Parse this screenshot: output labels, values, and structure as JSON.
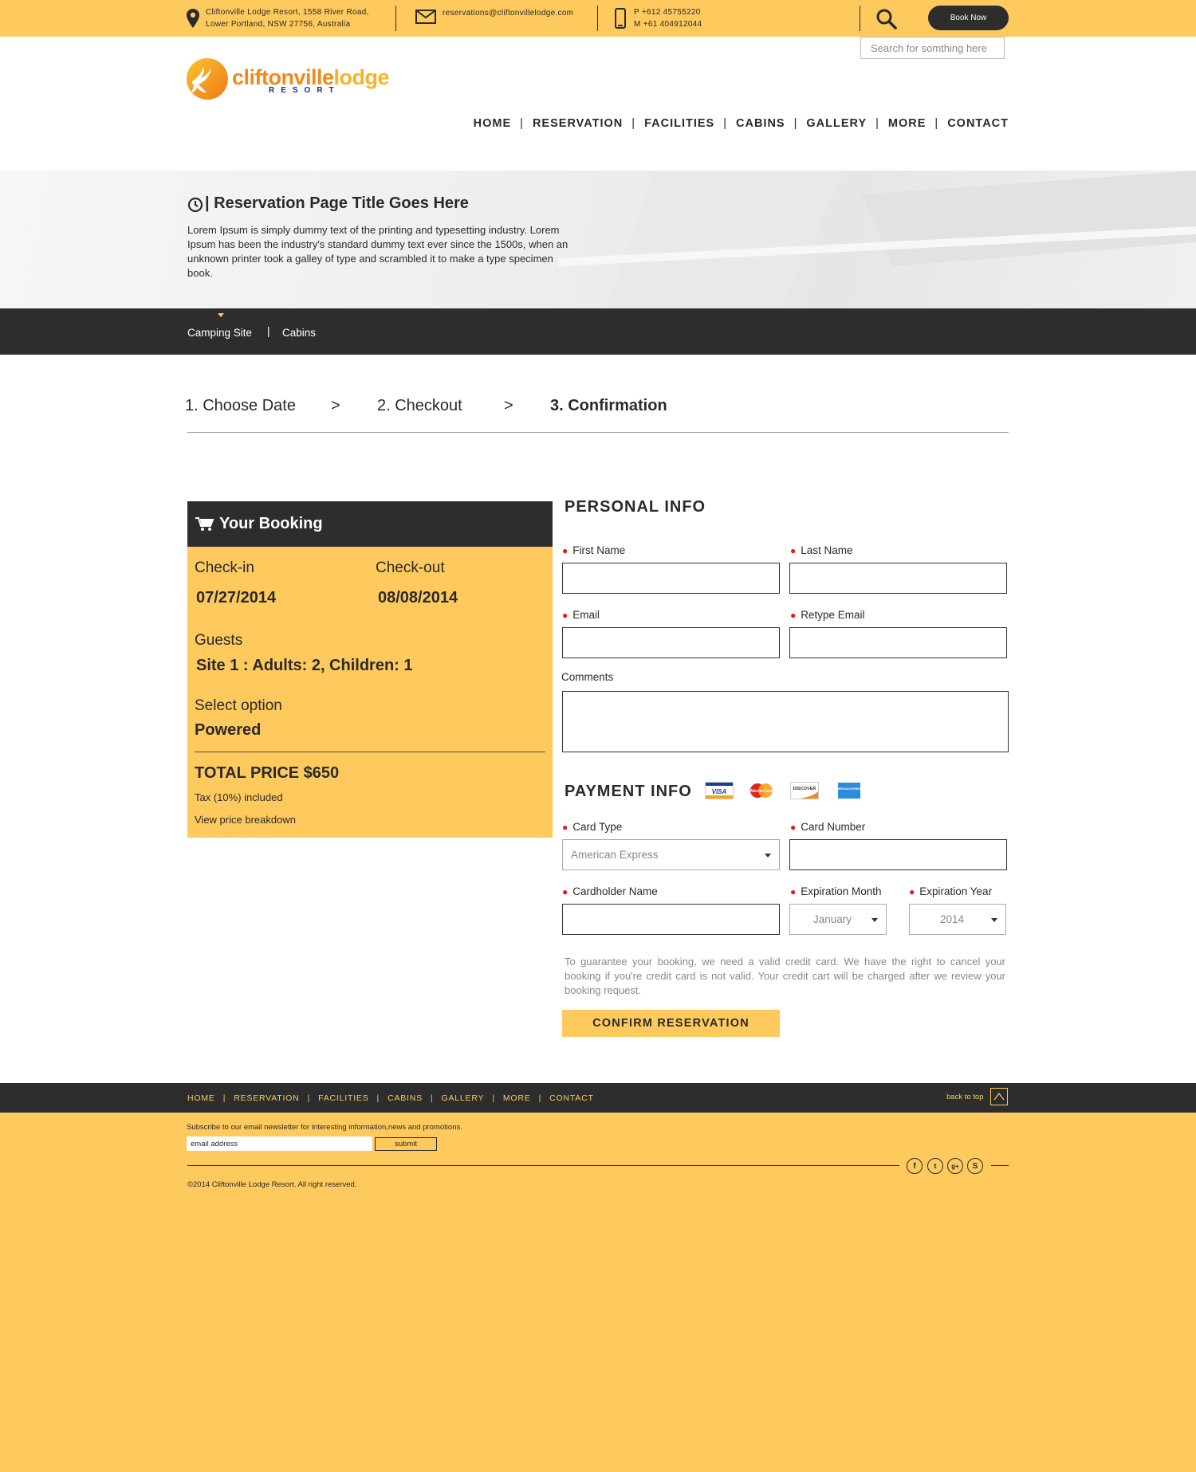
{
  "topbar": {
    "address_line1": "Cliftonville Lodge Resort, 1558 River Road,",
    "address_line2": "Lower Portland, NSW 27756, Australia",
    "email": "reservations@cliftonvillelodge.com",
    "phone_p": "P +612 45755220",
    "phone_m": "M +61 404912044",
    "book_now": "Book Now"
  },
  "search": {
    "placeholder": "Search for somthing here"
  },
  "logo": {
    "word_a": "cliftonville",
    "word_b": "lodge",
    "sub": "RESORT"
  },
  "nav": [
    "HOME",
    "RESERVATION",
    "FACILITIES",
    "CABINS",
    "GALLERY",
    "MORE",
    "CONTACT"
  ],
  "hero": {
    "title": "| Reservation Page Title Goes Here",
    "text": "Lorem Ipsum is simply dummy text of the printing and typesetting industry. Lorem Ipsum has been the industry's standard dummy text ever since the 1500s, when an unknown printer took a galley of type and scrambled it to make a type specimen book."
  },
  "subnav": {
    "items": [
      "Camping Site",
      "Cabins"
    ],
    "separator": "|"
  },
  "steps": {
    "step1": "1. Choose Date",
    "step2": "2. Checkout",
    "step3": "3. Confirmation",
    "arrow": ">"
  },
  "booking": {
    "title": "Your Booking",
    "checkin_label": "Check-in",
    "checkin_value": "07/27/2014",
    "checkout_label": "Check-out",
    "checkout_value": "08/08/2014",
    "guests_label": "Guests",
    "guests_value": "Site 1 : Adults: 2, Children: 1",
    "option_label": "Select option",
    "option_value": "Powered",
    "total": "TOTAL PRICE $650",
    "tax": "Tax (10%) included",
    "breakdown": "View price breakdown"
  },
  "personal": {
    "title": "PERSONAL INFO",
    "first_name": "First Name",
    "last_name": "Last Name",
    "email": "Email",
    "retype_email": "Retype Email",
    "comments": "Comments"
  },
  "payment": {
    "title": "PAYMENT INFO",
    "card_type": "Card Type",
    "card_type_value": "American Express",
    "card_number": "Card Number",
    "holder": "Cardholder Name",
    "exp_month": "Expiration Month",
    "exp_month_value": "January",
    "exp_year": "Expiration Year",
    "exp_year_value": "2014",
    "cards": {
      "visa": "VISA",
      "mastercard": "MasterCard",
      "discover": "DISCOVER",
      "amex": "AMERICAN EXPRESS"
    },
    "notice": "To guarantee your booking, we need a valid credit card. We have the right to cancel your booking if you're credit card is not valid. Your credit cart will be charged after we review your booking request.",
    "confirm": "CONFIRM RESERVATION"
  },
  "footer": {
    "nav": [
      "HOME",
      "RESERVATION",
      "FACILITIES",
      "CABINS",
      "GALLERY",
      "MORE",
      "CONTACT"
    ],
    "back_to_top": "back to top",
    "newsletter": "Subscribe to our email newsletter for interesting information,news and promotions.",
    "email_value": "email address",
    "submit": "submit",
    "social": [
      "f",
      "t",
      "g+",
      "S"
    ],
    "copyright": "©2014 Cliftonville Lodge Resort. All right reserved."
  },
  "colors": {
    "accent": "#fec95d",
    "dark": "#2d2d2d",
    "required": "#e01c1c"
  }
}
